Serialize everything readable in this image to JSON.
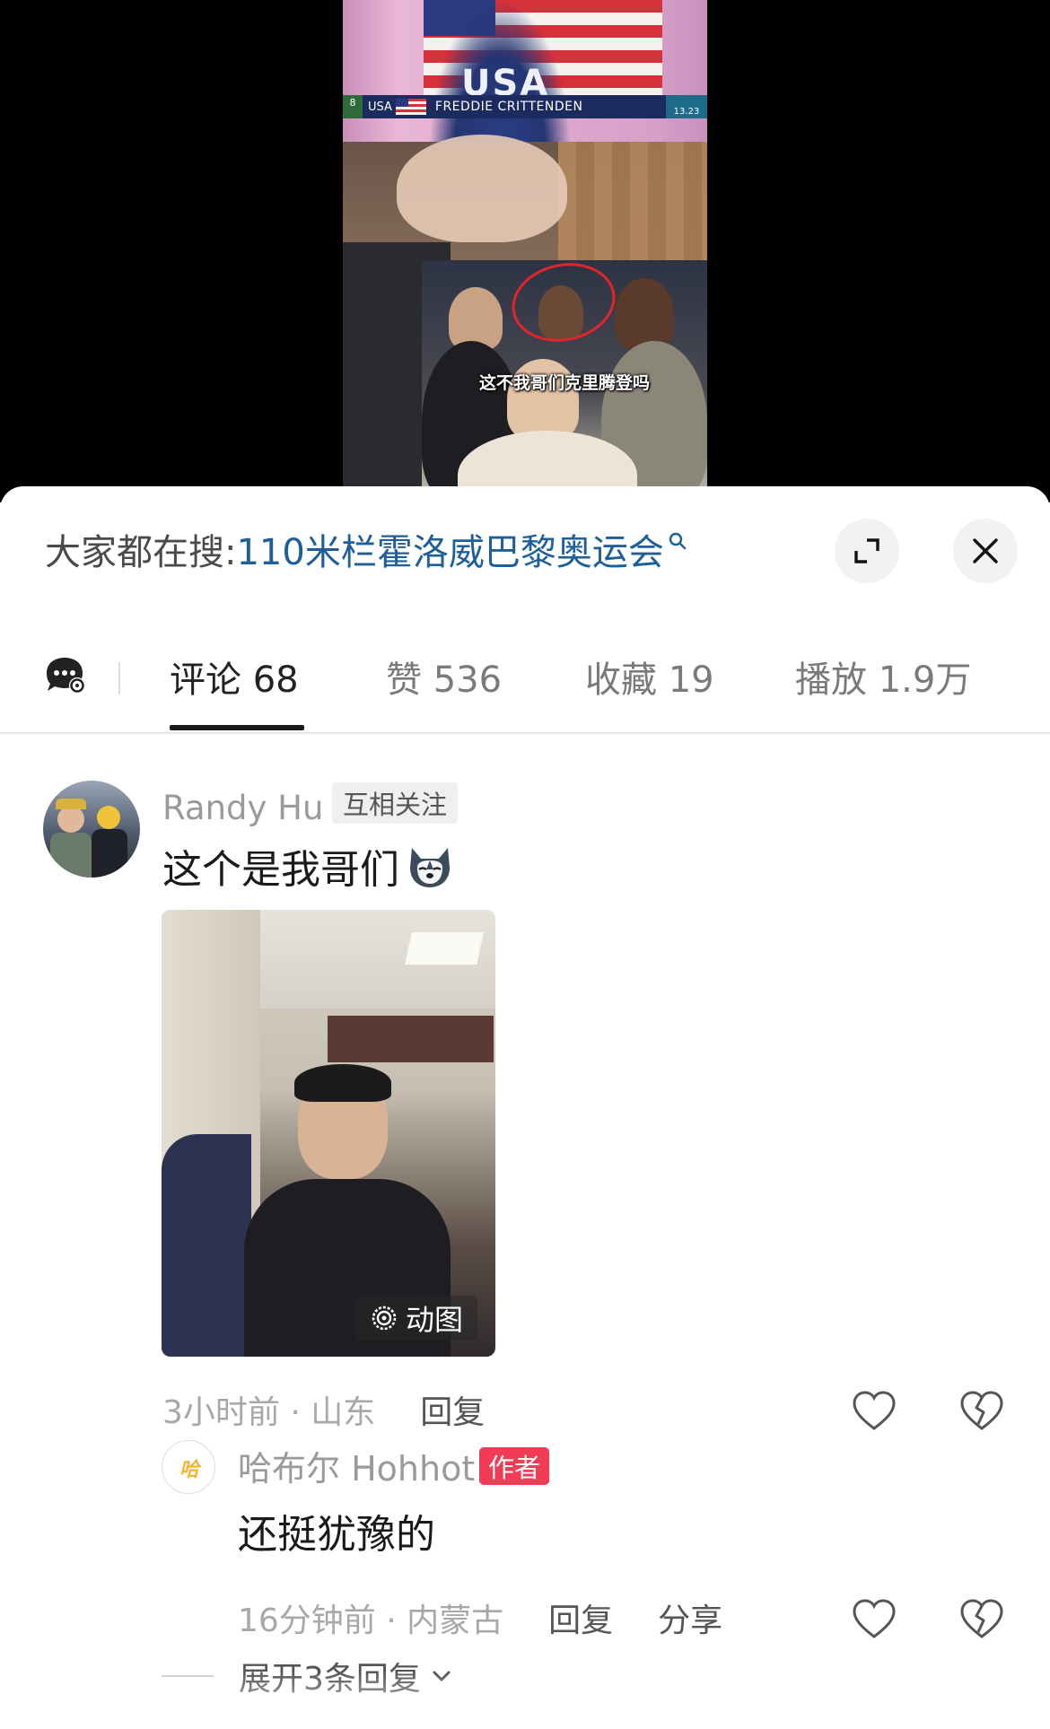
{
  "video": {
    "nameplate_country": "USA",
    "nameplate_name": "FREDDIE CRITTENDEN",
    "nameplate_lane": "8",
    "nameplate_time": "13.23",
    "chest_text": "USA",
    "subtitle": "这不我哥们克里腾登吗"
  },
  "search": {
    "prefix": "大家都在搜:",
    "term": "110米栏霍洛威巴黎奥运会"
  },
  "tabs": [
    {
      "label": "评论 68",
      "active": true
    },
    {
      "label": "赞 536",
      "active": false
    },
    {
      "label": "收藏 19",
      "active": false
    },
    {
      "label": "播放 1.9万",
      "active": false
    }
  ],
  "comment": {
    "username": "Randy Hu",
    "badge": "互相关注",
    "text": "这个是我哥们",
    "gif_label": "动图",
    "time_location": "3小时前 · 山东",
    "reply_label": "回复"
  },
  "reply": {
    "username": "哈布尔 Hohhot",
    "author_badge": "作者",
    "text": "还挺犹豫的",
    "time_location": "16分钟前 · 内蒙古",
    "reply_label": "回复",
    "share_label": "分享",
    "avatar_text": "哈"
  },
  "expand_replies": "展开3条回复",
  "colors": {
    "search_term": "#1e5f99",
    "author_badge": "#f23c55",
    "active_tab": "#222222",
    "inactive_tab": "#7a7a7a"
  }
}
